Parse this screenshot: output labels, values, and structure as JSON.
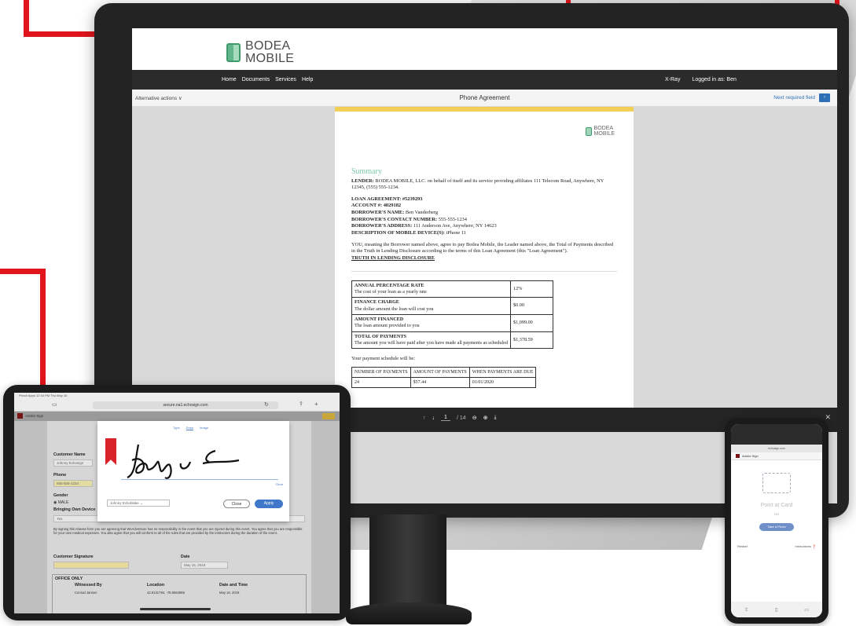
{
  "monitor": {
    "brand": {
      "line1": "BODEA",
      "line2": "MOBILE"
    },
    "nav": {
      "links": [
        "Home",
        "Documents",
        "Services",
        "Help"
      ],
      "xray": "X-Ray",
      "logged_in": "Logged in as: Ben"
    },
    "subbar": {
      "alternative_actions": "Alternative actions ∨",
      "title": "Phone Agreement",
      "next_required": "Next required field"
    },
    "document": {
      "logo": {
        "line1": "BODEA",
        "line2": "MOBILE"
      },
      "summary_heading": "Summary",
      "lender_label": "LENDER:",
      "lender_text": "BODEA MOBILE, LLC. on behalf of itself and its service providing affiliates 111 Telecom Road, Anywhere, NY 12345, (555) 555-1234.",
      "loan_agreement": "LOAN AGREEMENT: #5239293",
      "account": "ACCOUNT #: 4029182",
      "borrower_name_label": "BORROWER'S NAME:",
      "borrower_name": "Ben Vanderberg",
      "contact_label": "BORROWER'S CONTACT NUMBER:",
      "contact": "555-555-1234",
      "address_label": "BORROWER'S ADDRESS:",
      "address": "111 Anderson Ave, Anywhere, NY 14623",
      "device_label": "DESCRIPTION OF MOBILE DEVICE(S):",
      "device": "iPhone 11",
      "agreement_text": "YOU, meaning the Borrower named above, agree to pay Bodea Mobile, the Leader named above, the Total of Payments described in the Truth in Lending Disclosure according to the terms of this Loan Agreement (this \"Loan Agreement\").",
      "tila_heading": "TRUTH IN LENDING DISCLOSURE",
      "disclosure_rows": [
        {
          "label": "ANNUAL PERCENTAGE RATE",
          "desc": "The cost of your loan as a yearly rate",
          "value": "12%"
        },
        {
          "label": "FINANCE CHARGE",
          "desc": "The dollar amount the loan will cost you",
          "value": "$0.00"
        },
        {
          "label": "AMOUNT FINANCED",
          "desc": "The loan amount provided to you",
          "value": "$1,099.00"
        },
        {
          "label": "TOTAL OF PAYMENTS",
          "desc": "The amount you will have paid after you have made all payments as scheduled",
          "value": "$1,378.59"
        }
      ],
      "schedule_intro": "Your payment schedule will be:",
      "schedule_headers": [
        "NUMBER OF PAYMENTS",
        "AMOUNT OF PAYMENTS",
        "WHEN PAYMENTS ARE DUE"
      ],
      "schedule_row": [
        "24",
        "$57.44",
        "01/01/2020"
      ]
    },
    "pager": {
      "current": "1",
      "total": "/ 14"
    }
  },
  "tablet": {
    "status_time": "Pencil Apps  12:34 PM  Thu May 16",
    "url": "secure.na1.echosign.com",
    "app_title": "Adobe Sign",
    "customer_name_label": "Customer Name",
    "customer_name_value": "Johnny Echosign",
    "phone_label": "Phone",
    "phone_value": "555-555-1234",
    "gender_label": "Gender",
    "gender_value": "MALE",
    "bringing_label": "Bringing Own Device",
    "bringing_value": "Yes",
    "consent_text": "By signing this release form you are agreeing that WeAdventure has no responsibility in the event that you are injured during this event. You agree that you are responsible for your own medical expenses. You also agree that you will conform to all of the rules that are provided by the instructors during the duration of the event.",
    "customer_signature_label": "Customer Signature",
    "date_label": "Date",
    "date_value": "May 16, 2019",
    "office_only": "OFFICE ONLY",
    "witnessed_by_label": "Witnessed By",
    "witnessed_by_value": "Conrad Jansen",
    "location_label": "Location",
    "location_value": "42.9131794, -78.8564965",
    "date_time_label": "Date and Time",
    "date_time_value": "May 16, 2019",
    "sig_tabs": [
      "Type",
      "Draw",
      "Image"
    ],
    "sig_name_select": "Johnny Echoblake",
    "clear": "Clear",
    "close_btn": "Close",
    "apply_btn": "Apply"
  },
  "phone": {
    "app_title": "Adobe Sign",
    "point_card": "Point at Card",
    "or": "OR",
    "photo_btn": "Take a Photo",
    "restart": "Restart",
    "instructions": "Instructions"
  },
  "colors": {
    "brand_green": "#3f9a6b",
    "accent_red": "#e0141b",
    "link_blue": "#2f6fb6",
    "doc_top": "#f4cf55"
  }
}
